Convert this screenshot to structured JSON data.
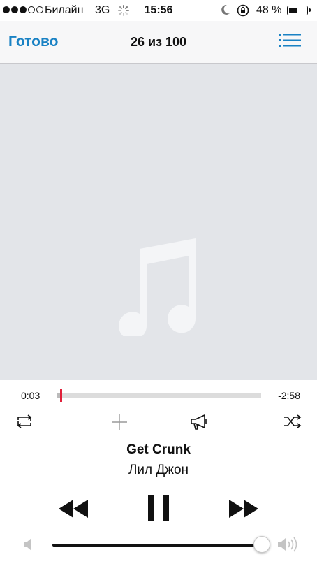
{
  "status_bar": {
    "signal_bars_filled": 3,
    "signal_bars_total": 5,
    "carrier": "Билайн",
    "network": "3G",
    "time": "15:56",
    "battery_percent_label": "48 %",
    "battery_level": 0.48,
    "icons": [
      "activity-spinner-icon",
      "moon-icon",
      "rotation-lock-icon",
      "battery-icon"
    ]
  },
  "nav": {
    "done_label": "Готово",
    "counter": "26 из 100",
    "list_icon": "list-icon"
  },
  "artwork": {
    "placeholder_icon": "music-note-icon"
  },
  "playback": {
    "elapsed": "0:03",
    "remaining": "-2:58",
    "progress": 0.017
  },
  "controls": {
    "icons": [
      "repeat-icon",
      "add-icon",
      "share-megaphone-icon",
      "shuffle-icon"
    ]
  },
  "track": {
    "title": "Get Crunk",
    "artist": "Лил Джон"
  },
  "transport": {
    "icons": [
      "rewind-icon",
      "pause-icon",
      "fast-forward-icon"
    ]
  },
  "volume": {
    "level": 1.0,
    "icons": [
      "volume-low-icon",
      "volume-high-icon"
    ]
  },
  "colors": {
    "accent": "#1a82c4",
    "playhead": "#e0203a",
    "artwork_bg": "#e3e5e9"
  }
}
